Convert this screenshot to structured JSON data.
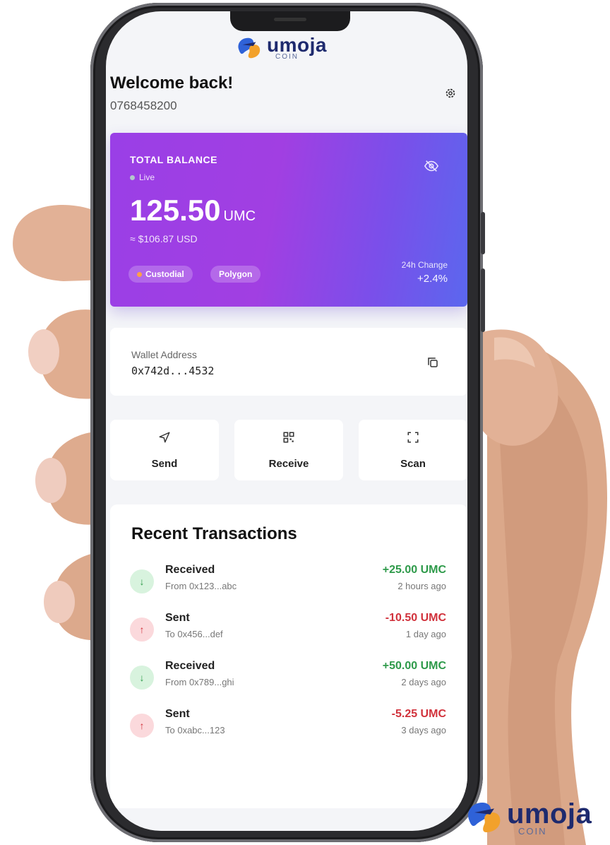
{
  "brand": {
    "name": "umoja",
    "sub": "COIN",
    "colors": {
      "navy": "#1e2a6e",
      "blue": "#2f62d8",
      "orange": "#f2a12b"
    }
  },
  "header": {
    "welcome": "Welcome back!",
    "phone": "0768458200",
    "settings_icon": "gear-icon"
  },
  "balance": {
    "label": "TOTAL BALANCE",
    "status": "Live",
    "amount": "125.50",
    "unit": "UMC",
    "usd": "≈ $106.87 USD",
    "chips": [
      "Custodial",
      "Polygon"
    ],
    "change_label": "24h Change",
    "change_value": "+2.4%",
    "toggle_icon": "eye-off-icon",
    "gradient": [
      "#9a3fe6",
      "#5b67ee"
    ]
  },
  "wallet": {
    "label": "Wallet Address",
    "address": "0x742d...4532",
    "copy_icon": "copy-icon"
  },
  "actions": [
    {
      "label": "Send",
      "icon": "send-icon"
    },
    {
      "label": "Receive",
      "icon": "qr-code-icon"
    },
    {
      "label": "Scan",
      "icon": "scan-icon"
    }
  ],
  "transactions": {
    "title": "Recent Transactions",
    "items": [
      {
        "type": "Received",
        "party": "From 0x123...abc",
        "amount": "+25.00 UMC",
        "time": "2 hours ago",
        "direction": "in"
      },
      {
        "type": "Sent",
        "party": "To 0x456...def",
        "amount": "-10.50 UMC",
        "time": "1 day ago",
        "direction": "out"
      },
      {
        "type": "Received",
        "party": "From 0x789...ghi",
        "amount": "+50.00 UMC",
        "time": "2 days ago",
        "direction": "in"
      },
      {
        "type": "Sent",
        "party": "To 0xabc...123",
        "amount": "-5.25 UMC",
        "time": "3 days ago",
        "direction": "out"
      }
    ]
  }
}
